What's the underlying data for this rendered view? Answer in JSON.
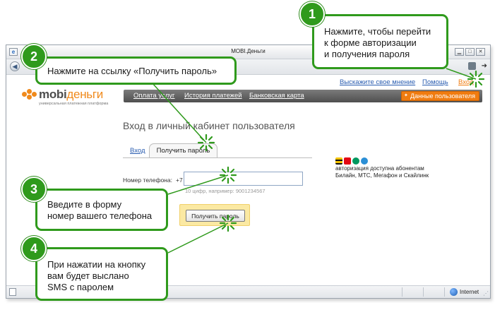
{
  "browser": {
    "title": "MOBI.Деньги",
    "zone_text": "Internet",
    "colors": {
      "accent": "#f07c10",
      "callout_green": "#2f9a1c"
    }
  },
  "site": {
    "top_links": [
      "Выскажите свое мнение",
      "Помощь",
      "Вход"
    ],
    "logo_main": "mobi",
    "logo_accent": "деньги",
    "logo_sub": "универсальная платежная платформа",
    "menu": [
      "Оплата услуг",
      "История платежей",
      "Банковская карта"
    ],
    "user_data_button": "Данные пользователя",
    "login_heading": "Вход в личный кабинет пользователя",
    "tabs": {
      "login": "Вход",
      "get_password": "Получить пароль"
    },
    "phone_label": "Номер телефона:",
    "phone_prefix": "+7",
    "phone_value": "",
    "phone_hint": "10 цифр, например: 9001234567",
    "submit_button": "Получить пароль",
    "operators_line1": "авторизация доступна абонентам",
    "operators_line2": "Билайн, МТС, Мегафон и Скайлинк"
  },
  "callouts": [
    {
      "num": "1",
      "lines": [
        "Нажмите, чтобы перейти",
        "к форме авторизации",
        "и получения пароля"
      ]
    },
    {
      "num": "2",
      "lines": [
        "Нажмите на ссылку «Получить пароль»"
      ]
    },
    {
      "num": "3",
      "lines": [
        "Введите в форму",
        "номер вашего телефона"
      ]
    },
    {
      "num": "4",
      "lines": [
        "При нажатии на кнопку",
        "вам будет выслано",
        "SMS с паролем"
      ]
    }
  ]
}
